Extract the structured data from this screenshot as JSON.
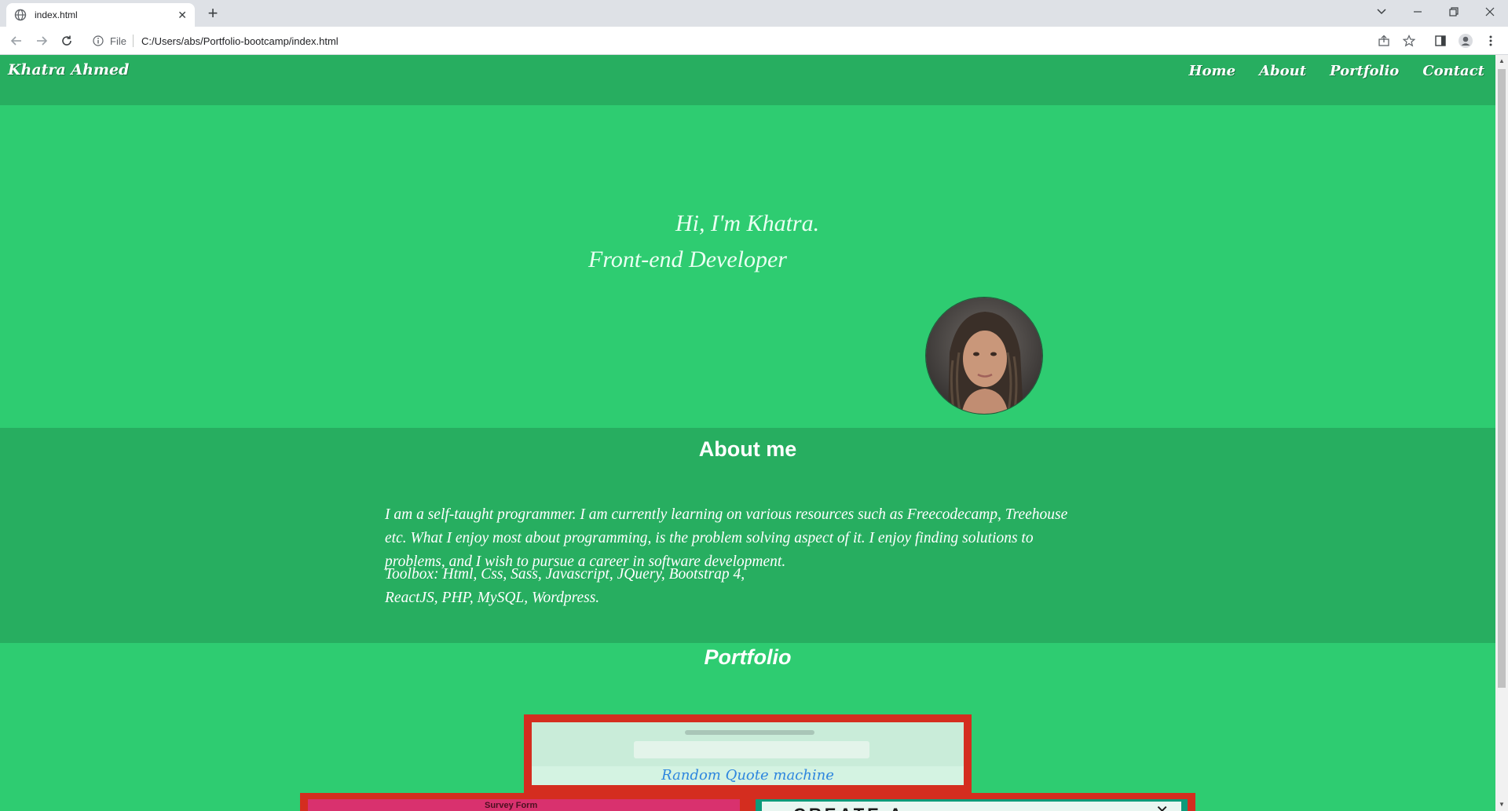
{
  "browser": {
    "tab_title": "index.html",
    "tab_close": "✕",
    "new_tab": "+",
    "omnibox_scheme": "File",
    "url": "C:/Users/abs/Portfolio-bootcamp/index.html"
  },
  "site": {
    "brand": "Khatra Ahmed",
    "nav": [
      "Home",
      "About",
      "Portfolio",
      "Contact"
    ]
  },
  "hero": {
    "greeting": "Hi, I'm Khatra.",
    "role": "Front-end Developer"
  },
  "about": {
    "title": "About me",
    "text": "I am a self-taught programmer. I am currently learning on various resources such as Freecodecamp, Treehouse etc. What I enjoy most about programming, is the problem solving aspect of it. I enjoy finding solutions to problems, and I wish to pursue a career in software development.",
    "toolbox": "Toolbox: Html, Css, Sass, Javascript, JQuery, Bootstrap 4, ReactJS, PHP, MySQL, Wordpress."
  },
  "portfolio": {
    "title": "Portfolio",
    "projects": [
      {
        "caption": "Random Quote machine"
      },
      {
        "caption": "Survey Form"
      },
      {
        "caption": "CREATE A"
      }
    ]
  },
  "colors": {
    "page_bg": "#2ecc71",
    "section_bg": "#27ae60",
    "card_border": "#d42d1f",
    "link": "#2e86de"
  }
}
